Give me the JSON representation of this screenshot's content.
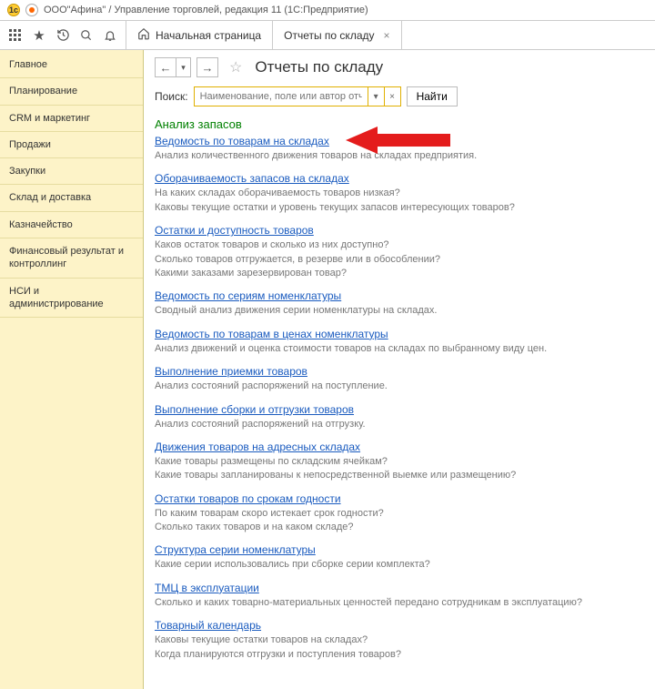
{
  "window_title": "ООО\"Афина\" / Управление торговлей, редакция 11  (1С:Предприятие)",
  "tabs": {
    "home": "Начальная страница",
    "reports": "Отчеты по складу"
  },
  "sidebar": {
    "items": [
      "Главное",
      "Планирование",
      "CRM и маркетинг",
      "Продажи",
      "Закупки",
      "Склад и доставка",
      "Казначейство",
      "Финансовый результат и контроллинг",
      "НСИ\nи администрирование"
    ]
  },
  "page_title": "Отчеты по складу",
  "search": {
    "label": "Поиск:",
    "placeholder": "Наименование, поле или автор отчета",
    "find": "Найти"
  },
  "section": "Анализ запасов",
  "reports": [
    {
      "link": "Ведомость по товарам на складах",
      "desc": "Анализ количественного движения товаров на складах предприятия.",
      "arrow": true
    },
    {
      "link": "Оборачиваемость запасов на складах",
      "desc": "На каких складах оборачиваемость товаров низкая?\nКаковы текущие остатки и уровень текущих запасов интересующих товаров?"
    },
    {
      "link": "Остатки и доступность товаров",
      "desc": "Каков остаток товаров и сколько из них доступно?\nСколько товаров отгружается, в резерве или в обособлении?\nКакими заказами зарезервирован товар?"
    },
    {
      "link": "Ведомость по сериям номенклатуры",
      "desc": "Сводный анализ движения серии номенклатуры на складах."
    },
    {
      "link": "Ведомость по товарам в ценах номенклатуры",
      "desc": "Анализ движений и оценка стоимости товаров на складах по выбранному виду цен."
    },
    {
      "link": "Выполнение приемки товаров",
      "desc": "Анализ состояний распоряжений на поступление."
    },
    {
      "link": "Выполнение сборки и отгрузки товаров",
      "desc": "Анализ состояний распоряжений на отгрузку."
    },
    {
      "link": "Движения товаров на адресных складах",
      "desc": "Какие товары размещены по складским ячейкам?\nКакие товары запланированы к непосредственной выемке или размещению?"
    },
    {
      "link": "Остатки товаров по срокам годности",
      "desc": "По каким товарам скоро истекает срок годности?\nСколько таких товаров и на каком складе?"
    },
    {
      "link": "Структура серии номенклатуры",
      "desc": "Какие серии использовались при сборке серии комплекта?"
    },
    {
      "link": "ТМЦ в эксплуатации",
      "desc": "Сколько и каких товарно-материальных ценностей передано сотрудникам в эксплуатацию?"
    },
    {
      "link": "Товарный календарь",
      "desc": "Каковы текущие остатки товаров на складах?\nКогда планируются отгрузки и поступления товаров?"
    }
  ]
}
